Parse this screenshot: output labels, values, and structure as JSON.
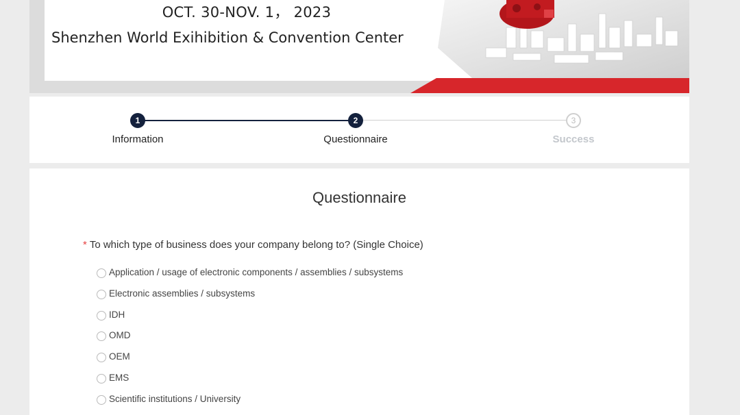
{
  "banner": {
    "date": "OCT. 30-NOV. 1， 2023",
    "venue": "Shenzhen World Exihibition & Convention Center"
  },
  "stepper": {
    "steps": [
      {
        "number": "1",
        "label": "Information",
        "state": "done"
      },
      {
        "number": "2",
        "label": "Questionnaire",
        "state": "done"
      },
      {
        "number": "3",
        "label": "Success",
        "state": "todo"
      }
    ]
  },
  "questionnaire": {
    "title": "Questionnaire",
    "question": {
      "required_mark": "*",
      "text": "To which type of business does your company belong to? (Single Choice)",
      "options": [
        "Application / usage of electronic components / assemblies / subsystems",
        "Electronic assemblies / subsystems",
        "IDH",
        "OMD",
        "OEM",
        "EMS",
        "Scientific institutions / University"
      ]
    }
  },
  "colors": {
    "accent_red": "#d7262b",
    "step_active": "#14213d",
    "step_inactive": "#cfcfcf"
  }
}
